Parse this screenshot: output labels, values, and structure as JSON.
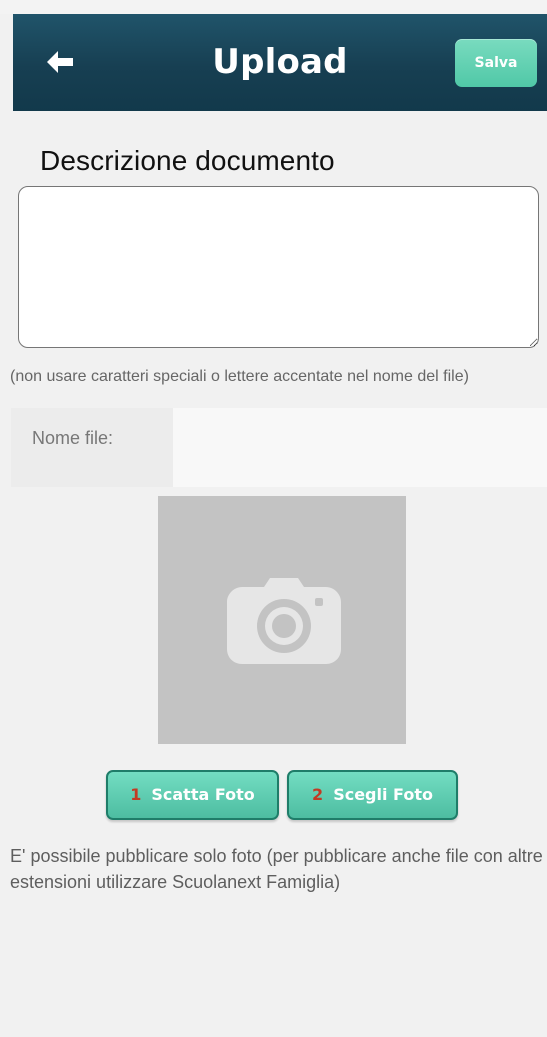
{
  "header": {
    "title": "Upload",
    "save_label": "Salva",
    "back_icon": "arrow-left-icon"
  },
  "document": {
    "description_label": "Descrizione documento",
    "description_value": "",
    "filename_help": "(non usare caratteri speciali o lettere accentate nel nome del file)",
    "filename_label": "Nome file:",
    "filename_value": ""
  },
  "photo": {
    "placeholder_icon": "camera-icon"
  },
  "actions": [
    {
      "number": "1",
      "label": "Scatta Foto"
    },
    {
      "number": "2",
      "label": "Scegli Foto"
    }
  ],
  "footer": {
    "text": "E' possibile pubblicare solo foto (per pubblicare anche file con altre estensioni utilizzare Scuolanext Famiglia)"
  },
  "colors": {
    "header": "#173f52",
    "accent": "#50c8a7",
    "button_number": "#c23b24"
  }
}
